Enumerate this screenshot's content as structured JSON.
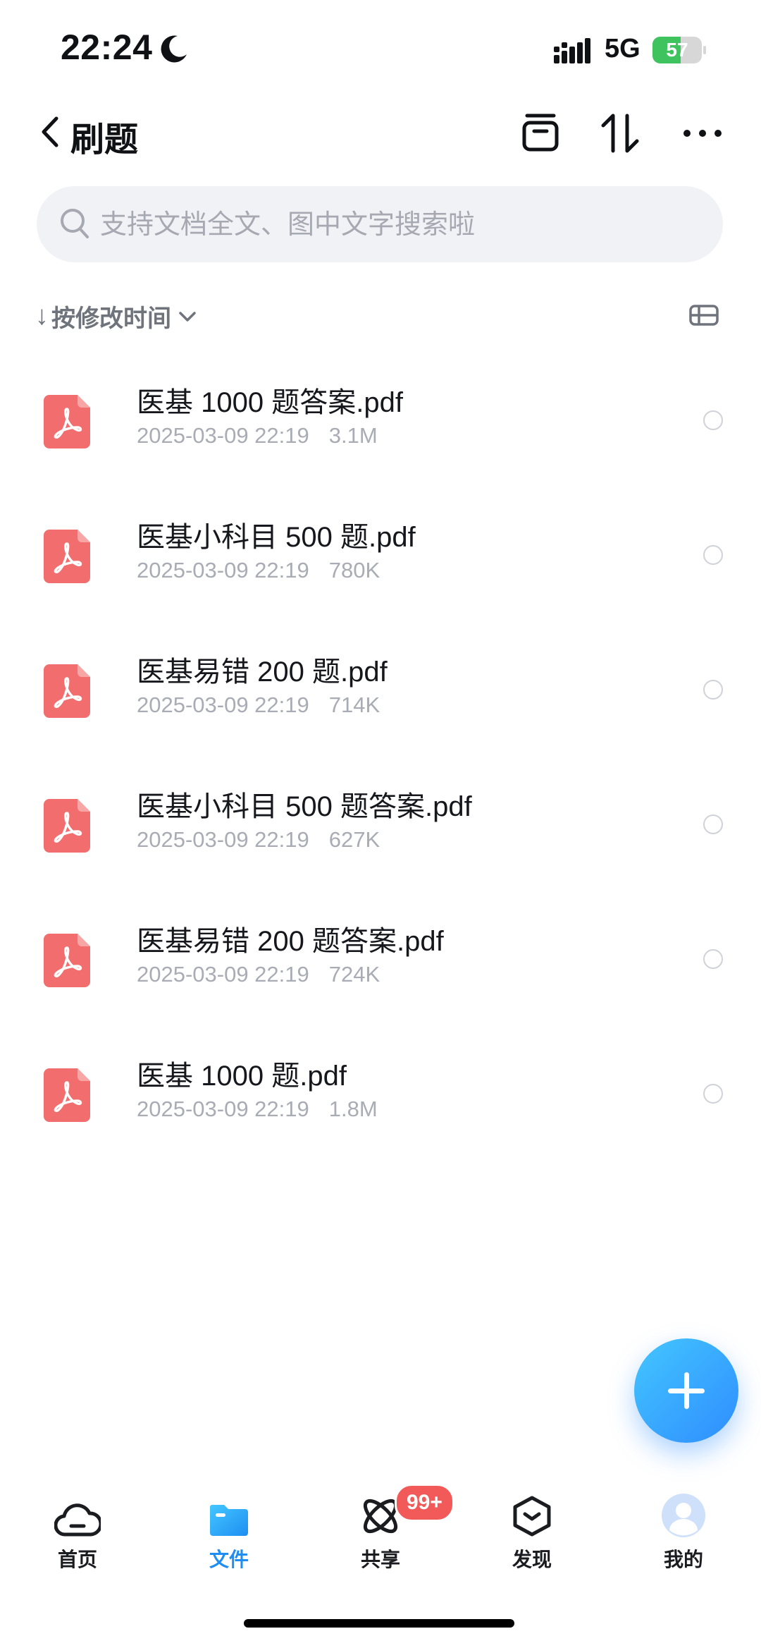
{
  "status_bar": {
    "time": "22:24",
    "network": "5G",
    "battery": "57",
    "battery_level": 0.57
  },
  "header": {
    "title": "刷题"
  },
  "search": {
    "placeholder": "支持文档全文、图中文字搜索啦"
  },
  "sort": {
    "label": "按修改时间"
  },
  "files": [
    {
      "name": "医基 1000 题答案.pdf",
      "date": "2025-03-09 22:19",
      "size": "3.1M"
    },
    {
      "name": "医基小科目 500 题.pdf",
      "date": "2025-03-09 22:19",
      "size": "780K"
    },
    {
      "name": "医基易错 200 题.pdf",
      "date": "2025-03-09 22:19",
      "size": "714K"
    },
    {
      "name": "医基小科目 500 题答案.pdf",
      "date": "2025-03-09 22:19",
      "size": "627K"
    },
    {
      "name": "医基易错 200 题答案.pdf",
      "date": "2025-03-09 22:19",
      "size": "724K"
    },
    {
      "name": "医基 1000 题.pdf",
      "date": "2025-03-09 22:19",
      "size": "1.8M"
    }
  ],
  "nav": {
    "tabs": [
      {
        "label": "首页",
        "icon": "cloud-icon"
      },
      {
        "label": "文件",
        "icon": "folder-icon",
        "active": true
      },
      {
        "label": "共享",
        "icon": "share-orbit-icon"
      },
      {
        "label": "发现",
        "icon": "discover-box-icon"
      },
      {
        "label": "我的",
        "icon": "avatar-icon"
      }
    ],
    "share_badge": "99+"
  },
  "colors": {
    "accent": "#1e8ef2",
    "pdf": "#f26d6d",
    "badge": "#f25a5a"
  }
}
